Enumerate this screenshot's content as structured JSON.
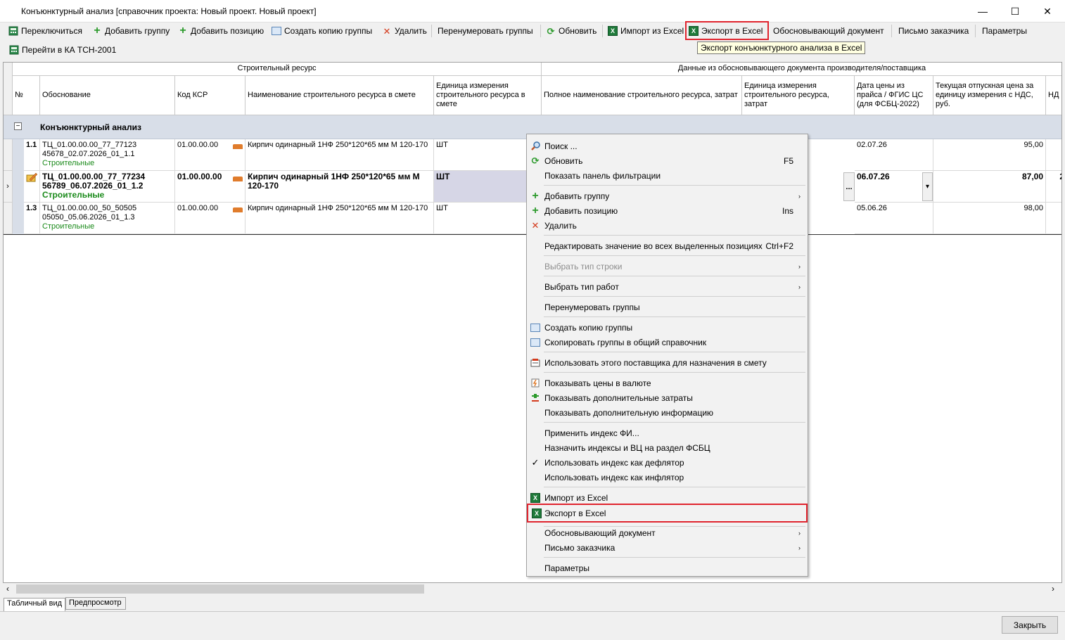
{
  "window": {
    "title": "Конъюнктурный анализ [справочник проекта: Новый проект. Новый проект]",
    "minimize": "—",
    "maximize": "☐",
    "close": "✕"
  },
  "toolbar": {
    "switch": "Переключиться",
    "add_group": "Добавить группу",
    "add_position": "Добавить позицию",
    "copy_group": "Создать копию группы",
    "delete": "Удалить",
    "renumber": "Перенумеровать группы",
    "refresh": "Обновить",
    "import_excel": "Импорт из Excel",
    "export_excel": "Экспорт в Excel",
    "justifying_doc": "Обосновывающий документ",
    "customer_letter": "Письмо заказчика",
    "params": "Параметры",
    "goto_tsn": "Перейти в КА ТСН-2001",
    "tooltip": "Экспорт конъюнктурного анализа в Excel"
  },
  "grid": {
    "band_resource": "Строительный ресурс",
    "band_supplier": "Данные из обосновывающего документа производителя/поставщика",
    "columns": {
      "num": "№",
      "basis": "Обоснование",
      "ksr": "Код КСР",
      "name_in_estimate": "Наименование строительного ресурса в смете",
      "unit_in_estimate": "Единица измерения строительного ресурса в смете",
      "full_name": "Полное наименование строительного ресурса, затрат",
      "unit_cost": "Единица измерения строительного ресурса, затрат",
      "price_date": "Дата цены из прайса / ФГИС ЦС (для ФСБЦ-2022)",
      "current_price": "Текущая отпускная цена за единицу измерения с НДС, руб.",
      "vat": "НД"
    },
    "group": {
      "toggle": "−",
      "label": "Конъюнктурный анализ"
    },
    "rows": [
      {
        "num": "1.1",
        "basis_line1": "ТЦ_01.00.00.00_77_77123",
        "basis_line2": "45678_02.07.2026_01_1.1",
        "basis_type": "Строительные",
        "ksr": "01.00.00.00",
        "name": "Кирпич одинарный 1НФ 250*120*65 мм М 120-170",
        "unit": "ШТ",
        "date": "02.07.26",
        "price": "95,00"
      },
      {
        "num": "",
        "basis_line1": "ТЦ_01.00.00.00_77_77234",
        "basis_line2": "56789_06.07.2026_01_1.2",
        "basis_type": "Строительные",
        "ksr": "01.00.00.00",
        "name": "Кирпич одинарный 1НФ 250*120*65 мм М 120-170",
        "unit": "ШТ",
        "date": "06.07.26",
        "price": "87,00",
        "vat": "2",
        "indicator": "›",
        "ellipsis": "...",
        "dropdown": "▾"
      },
      {
        "num": "1.3",
        "basis_line1": "ТЦ_01.00.00.00_50_50505",
        "basis_line2": "05050_05.06.2026_01_1.3",
        "basis_type": "Строительные",
        "ksr": "01.00.00.00",
        "name": "Кирпич одинарный 1НФ 250*120*65 мм М 120-170",
        "unit": "ШТ",
        "date": "05.06.26",
        "price": "98,00"
      }
    ]
  },
  "context_menu": {
    "search": "Поиск ...",
    "refresh": "Обновить",
    "refresh_shortcut": "F5",
    "show_filter": "Показать панель фильтрации",
    "add_group": "Добавить группу",
    "add_position": "Добавить позицию",
    "add_position_shortcut": "Ins",
    "delete": "Удалить",
    "edit_all": "Редактировать значение во всех выделенных позициях",
    "edit_all_shortcut": "Ctrl+F2",
    "row_type": "Выбрать тип строки",
    "work_type": "Выбрать тип работ",
    "renumber": "Перенумеровать группы",
    "copy_group": "Создать копию группы",
    "copy_to_common": "Скопировать группы в общий справочник",
    "use_supplier": "Использовать этого поставщика для назначения в смету",
    "show_currency": "Показывать цены в валюте",
    "show_extra_costs": "Показывать дополнительные затраты",
    "show_extra_info": "Показывать дополнительную информацию",
    "apply_index": "Применить индекс ФИ...",
    "assign_indexes": "Назначить индексы и ВЦ на раздел ФСБЦ",
    "deflator": "Использовать индекс как дефлятор",
    "inflator": "Использовать индекс как инфлятор",
    "import_excel": "Импорт из Excel",
    "export_excel": "Экспорт в Excel",
    "justifying_doc": "Обосновывающий документ",
    "customer_letter": "Письмо заказчика",
    "params": "Параметры",
    "arrow": "›",
    "check": "✓"
  },
  "tabs": {
    "table_view": "Табличный вид",
    "preview": "Предпросмотр"
  },
  "footer": {
    "close": "Закрыть"
  },
  "scroll": {
    "left": "‹",
    "right": "›"
  },
  "colors": {
    "highlight": "#e0242e",
    "group_bg": "#d8dee8",
    "selected_cell": "#d6d6e6",
    "green_text": "#1a8a1a"
  }
}
